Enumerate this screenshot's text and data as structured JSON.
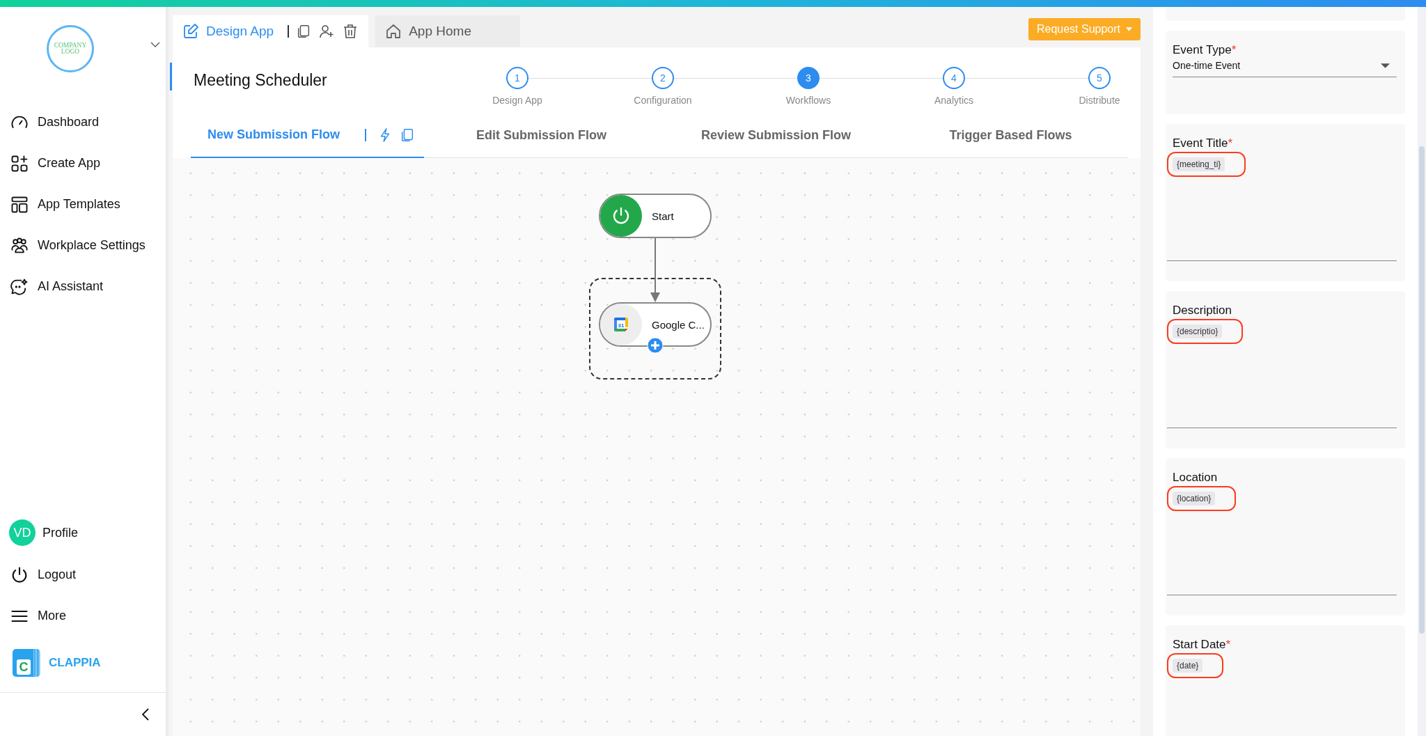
{
  "sidebar": {
    "logo_lines": [
      "COMPANY",
      "LOGO"
    ],
    "items": [
      {
        "label": "Dashboard"
      },
      {
        "label": "Create App"
      },
      {
        "label": "App Templates"
      },
      {
        "label": "Workplace Settings"
      },
      {
        "label": "AI Assistant"
      }
    ],
    "profile": {
      "initials": "VD",
      "label": "Profile"
    },
    "bottom_items": [
      {
        "label": "Logout"
      },
      {
        "label": "More"
      }
    ],
    "brand": {
      "mark": "C",
      "name": "CLAPPIA"
    }
  },
  "header": {
    "tabs": [
      {
        "label": "Design App",
        "selected": true
      },
      {
        "label": "App Home",
        "selected": false
      }
    ],
    "support_button": "Request Support"
  },
  "app_title": "Meeting Scheduler",
  "steps": [
    {
      "number": "1",
      "label": "Design App",
      "selected": false
    },
    {
      "number": "2",
      "label": "Configuration",
      "selected": false
    },
    {
      "number": "3",
      "label": "Workflows",
      "selected": true
    },
    {
      "number": "4",
      "label": "Analytics",
      "selected": false
    },
    {
      "number": "5",
      "label": "Distribute",
      "selected": false
    }
  ],
  "flow_tabs": [
    {
      "label": "New Submission Flow",
      "selected": true
    },
    {
      "label": "Edit Submission Flow",
      "selected": false
    },
    {
      "label": "Review Submission Flow",
      "selected": false
    },
    {
      "label": "Trigger Based Flows",
      "selected": false
    }
  ],
  "nodes": [
    {
      "kind": "start",
      "label": "Start"
    },
    {
      "kind": "calendar",
      "label": "Google C...",
      "calendar_day": "31"
    }
  ],
  "panel": {
    "fields": [
      {
        "kind": "select",
        "label": "Event Type",
        "mark": "*",
        "value": "One-time Event"
      },
      {
        "kind": "textarea",
        "label": "Event Title",
        "mark": "*",
        "chip": "{meeting_ti}"
      },
      {
        "kind": "textarea",
        "label": "Description",
        "chip": "{descriptio}"
      },
      {
        "kind": "textarea",
        "label": "Location",
        "chip": "{location}"
      },
      {
        "kind": "textarea",
        "label": "Start Date",
        "mark": "*",
        "chip": "{date}"
      }
    ]
  }
}
